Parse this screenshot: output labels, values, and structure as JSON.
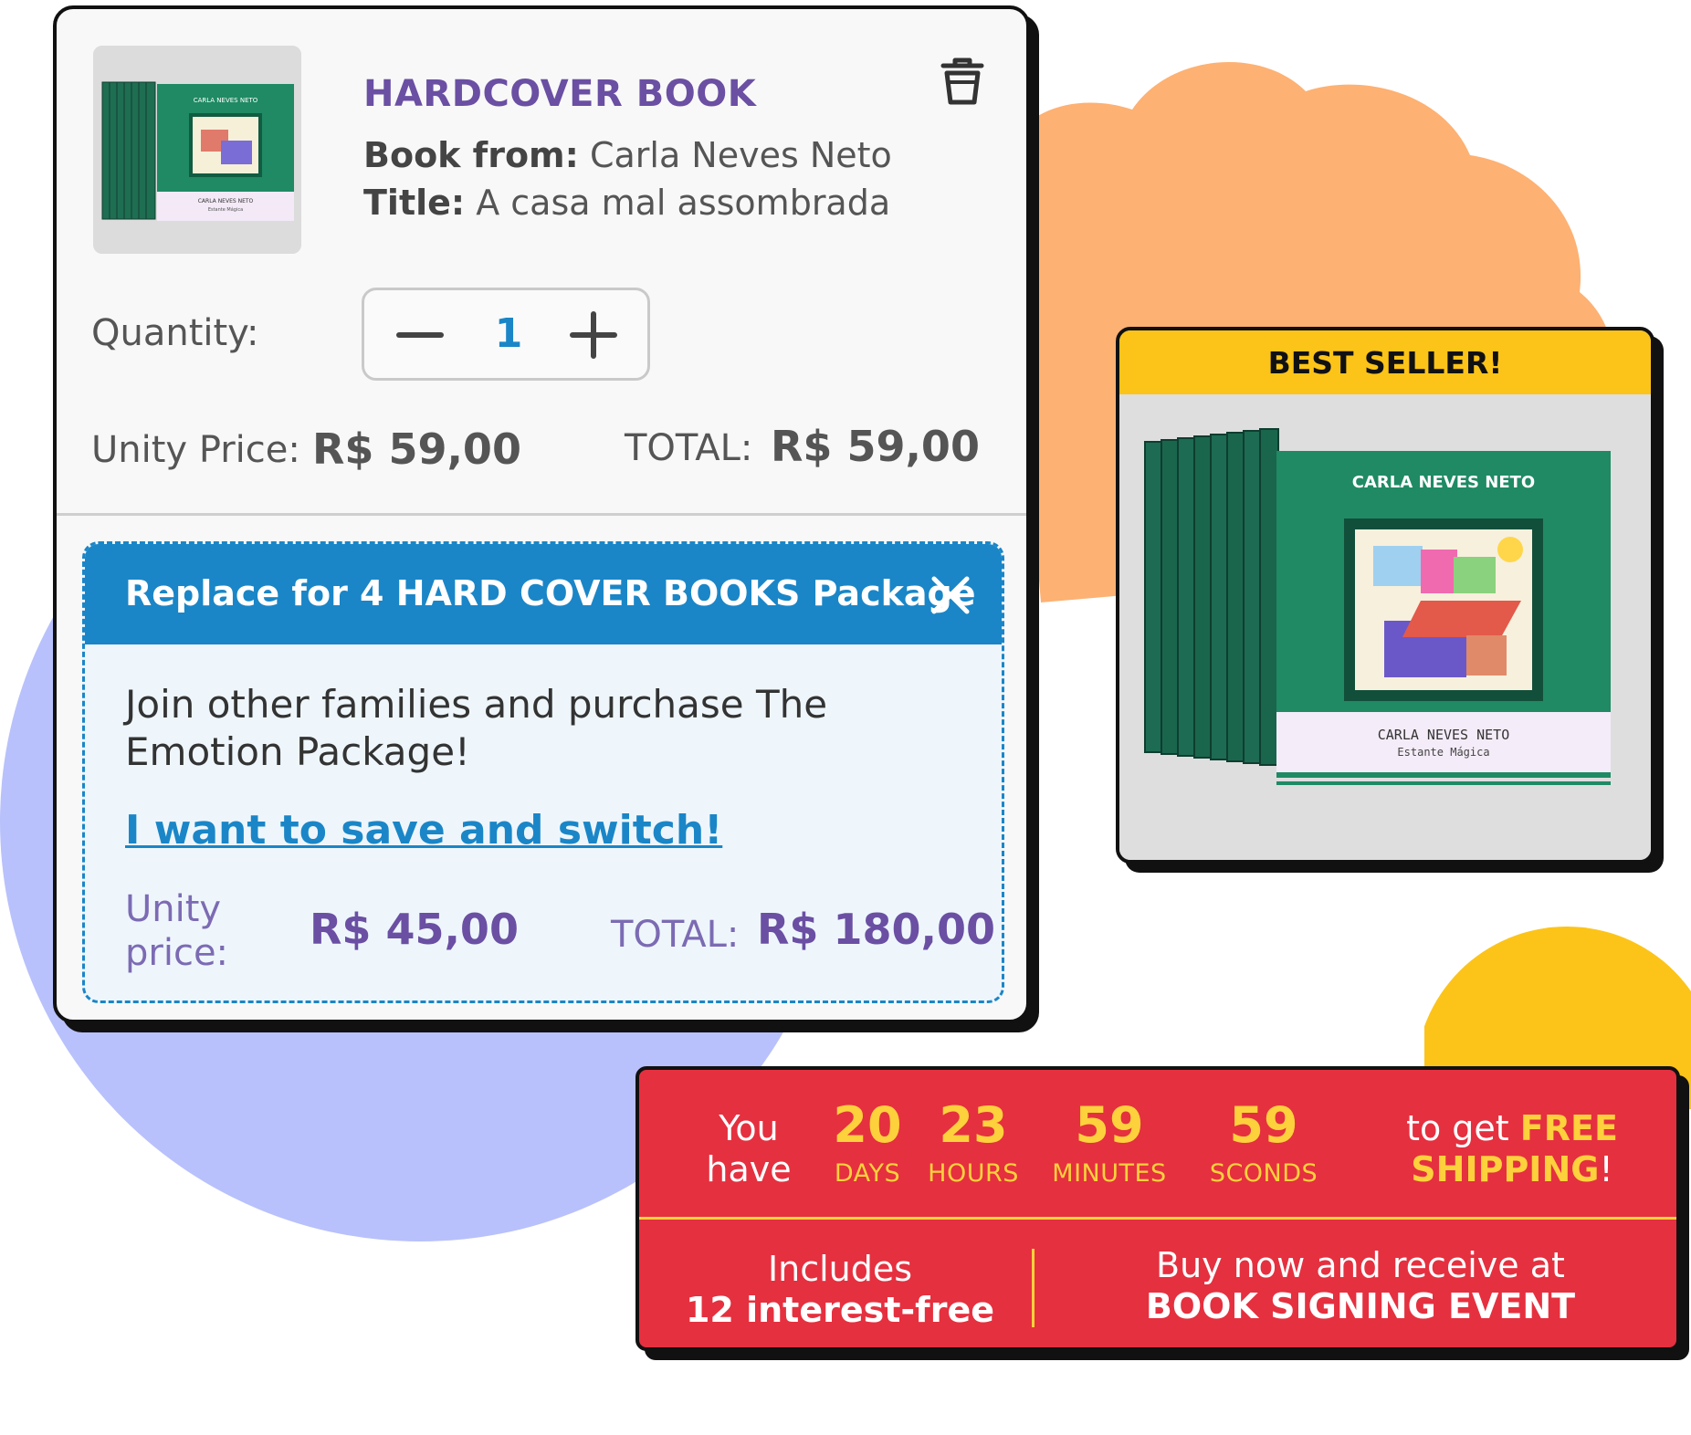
{
  "cart": {
    "product_name": "HARDCOVER BOOK",
    "author_label": "Book from:",
    "author_value": " Carla Neves Neto",
    "title_label": "Title:",
    "title_value": " A casa mal assombrada",
    "quantity_label": "Quantity:",
    "quantity_value": "1",
    "unit_price_label": "Unity Price:",
    "unit_price_value": "R$ 59,00",
    "total_label": "TOTAL:",
    "total_value": "R$ 59,00",
    "thumb_cover_author": "CARLA NEVES NETO",
    "thumb_cover_series": "Estante Mágica"
  },
  "offer": {
    "title": "Replace for 4 HARD COVER BOOKS Package",
    "text": "Join other families and purchase The Emotion Package!",
    "link": "I want to save and switch!",
    "unit_price_label": "Unity price:",
    "unit_price_value": "R$ 45,00",
    "total_label": "TOTAL:",
    "total_value": "R$ 180,00"
  },
  "best_seller": {
    "label": "BEST SELLER!",
    "cover_top": "CARLA NEVES NETO",
    "cover_author": "CARLA NEVES NETO",
    "cover_series": "Estante Mágica"
  },
  "promo": {
    "you_have": "You have",
    "countdown": [
      {
        "value": "20",
        "unit": "DAYS"
      },
      {
        "value": "23",
        "unit": "HOURS"
      },
      {
        "value": "59",
        "unit": "MINUTES"
      },
      {
        "value": "59",
        "unit": "SCONDS"
      }
    ],
    "free_shipping_prefix": "to get ",
    "free_shipping_highlight": "FREE SHIPPING",
    "free_shipping_suffix": "!",
    "includes_line1": "Includes",
    "includes_line2": "12 interest-free",
    "signing_line1": "Buy now and receive at",
    "signing_line2": "BOOK SIGNING EVENT"
  },
  "colors": {
    "purple": "#6a4fa3",
    "blue": "#1a86c7",
    "orange_blob": "#fdb173",
    "lilac_blob": "#b8c1fb",
    "yellow": "#fcc419",
    "promo_red": "#e5303f",
    "book_green": "#1f8a64"
  },
  "icons": {
    "trash": "trash-icon",
    "minus": "minus-icon",
    "plus": "plus-icon",
    "close": "close-icon"
  }
}
